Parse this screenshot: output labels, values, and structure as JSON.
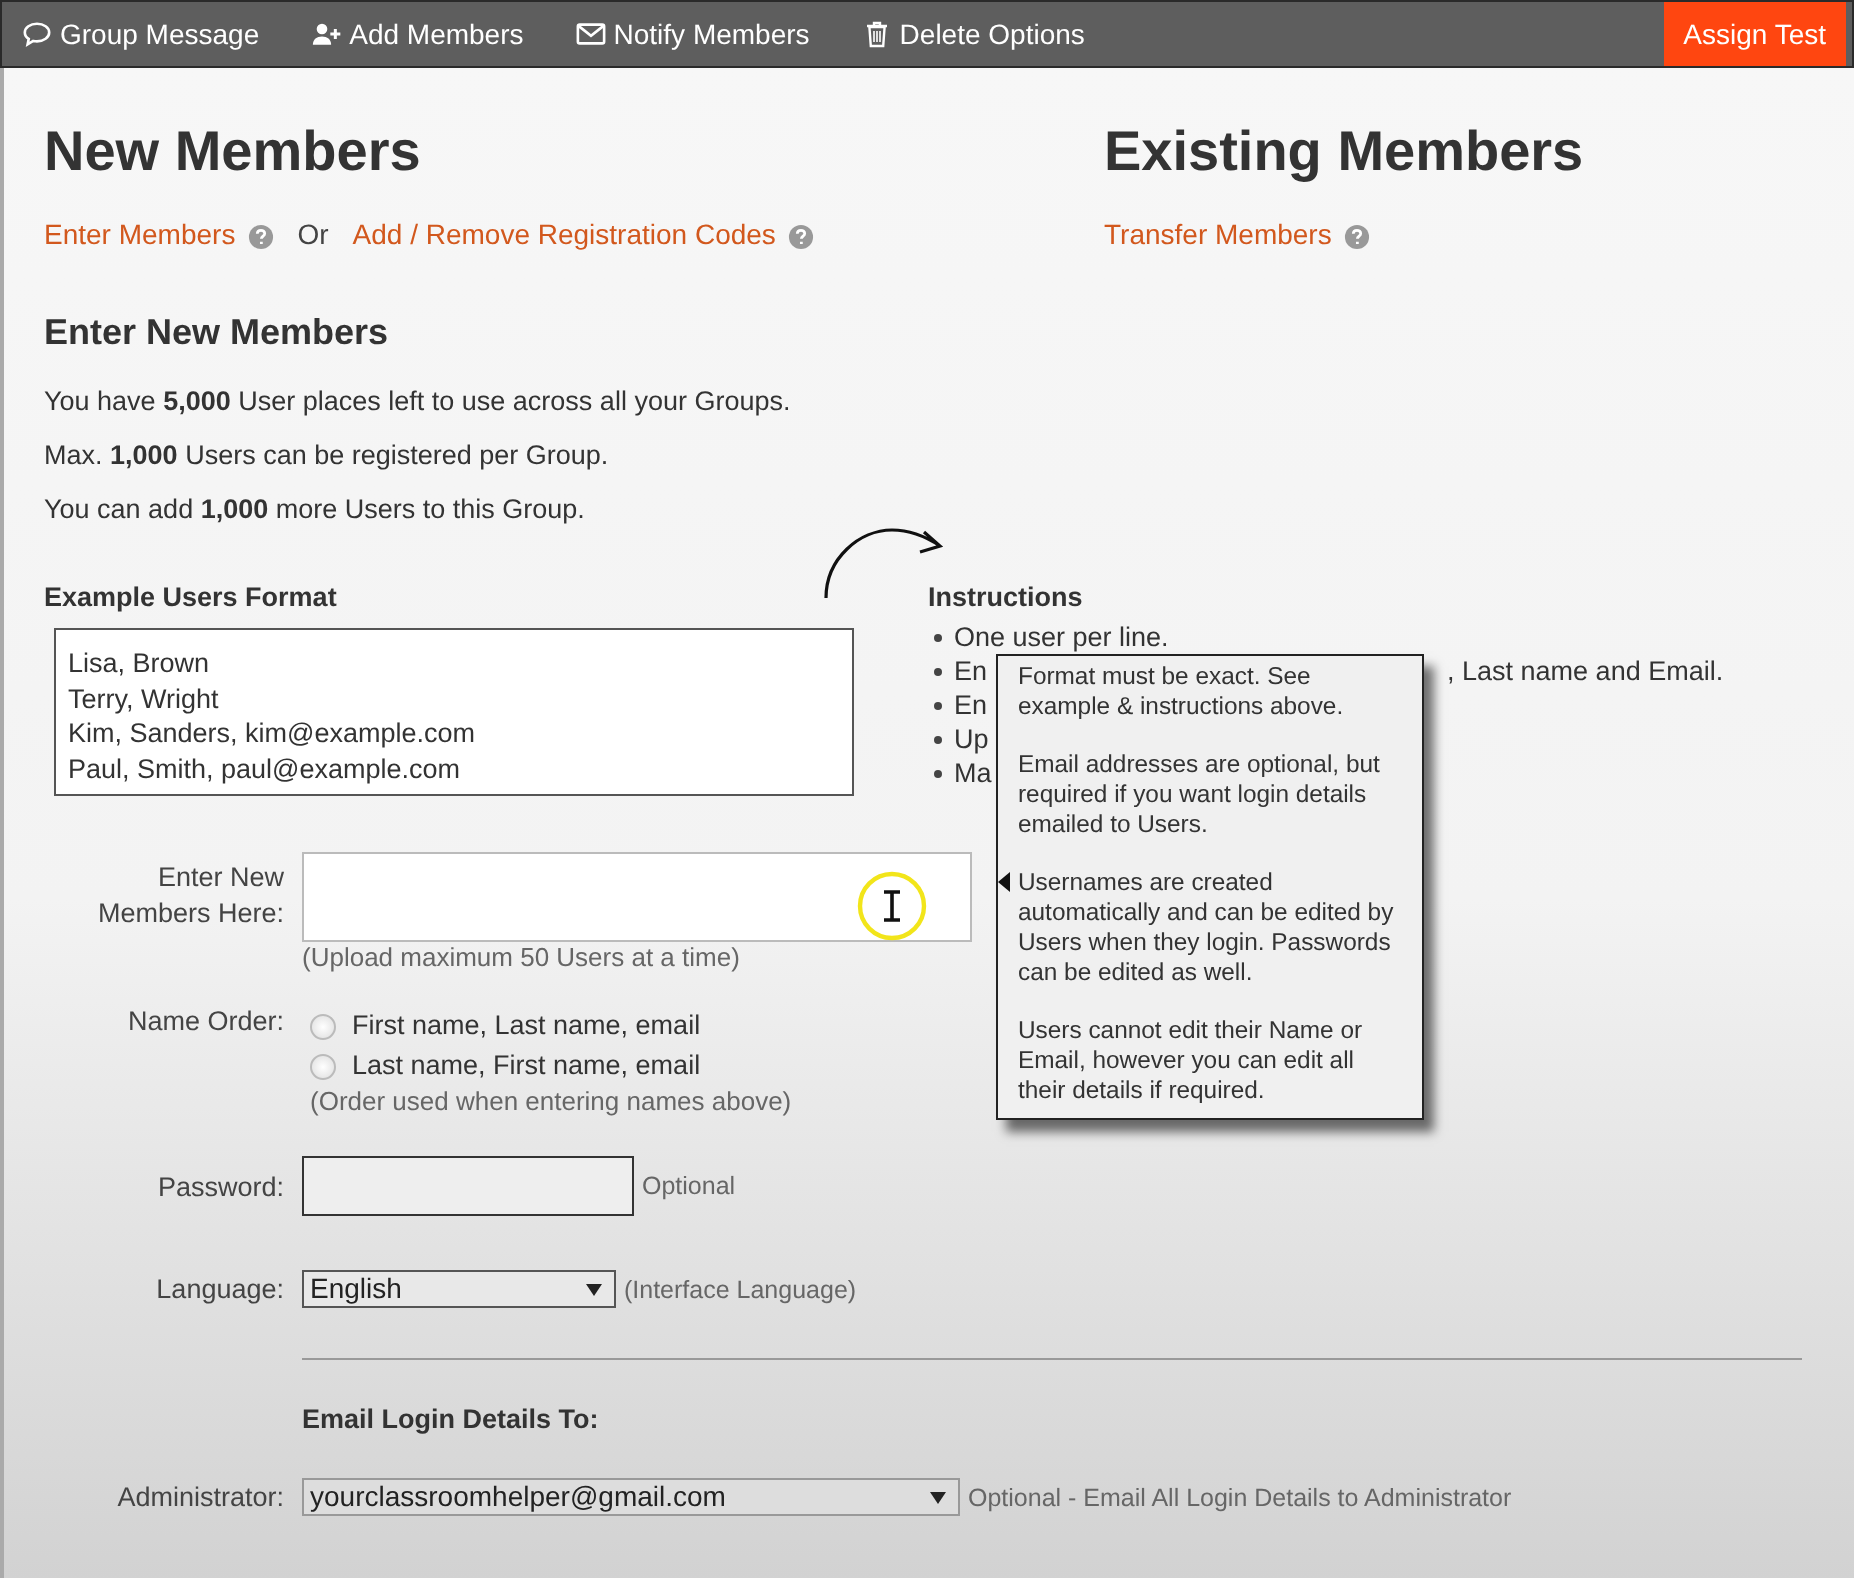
{
  "toolbar": {
    "items": [
      {
        "kind": "chat",
        "label": "Group Message"
      },
      {
        "kind": "user-plus",
        "label": "Add Members"
      },
      {
        "kind": "envelope",
        "label": "Notify Members"
      },
      {
        "kind": "trash",
        "label": "Delete Options"
      }
    ],
    "action_button": "Assign Test"
  },
  "new_members": {
    "title": "New Members",
    "link_1": "Enter Members",
    "separator": "Or",
    "link_2": "Add / Remove Registration Codes"
  },
  "existing_members": {
    "title": "Existing Members",
    "link": "Transfer Members"
  },
  "section_title": "Enter New Members",
  "info_lines": [
    "You have **5,000** User places left to use across all your Groups.",
    "Max. **1,000** Users can be registered per Group.",
    "You can add **1,000** more Users to this Group."
  ],
  "example": {
    "label": "Example Users Format",
    "lines": [
      "Lisa, Brown",
      "Terry, Wright",
      "Kim, Sanders, kim@example.com",
      "Paul, Smith, paul@example.com"
    ]
  },
  "instructions": {
    "title": "Instructions",
    "items": [
      {
        "start": "One user per line."
      },
      {
        "start": "En",
        "end": ", Last name and Email."
      },
      {
        "start": "En"
      },
      {
        "start": "Up"
      },
      {
        "start": "Ma"
      }
    ]
  },
  "tooltip": {
    "paragraphs": [
      "Format must be exact. See example & instructions above.",
      "Email addresses are optional, but required if you want login details emailed to Users.",
      "Usernames are created automatically and can be edited by Users when they login. Passwords can be edited as well.",
      "Users cannot edit their Name or Email, however you can edit all their details if required."
    ]
  },
  "members_field": {
    "label": "Enter New Members Here:",
    "note": "(Upload maximum 50 Users at a time)"
  },
  "name_order": {
    "label": "Name Order:",
    "options": [
      {
        "label": "First name, Last name, email",
        "selected": false
      },
      {
        "label": "Last name, First name, email",
        "selected": false
      }
    ],
    "note": "(Order used when entering names above)"
  },
  "password": {
    "label": "Password:",
    "hint": "Optional"
  },
  "language": {
    "label": "Language:",
    "value": "English",
    "hint": "(Interface Language)"
  },
  "email_section": {
    "title": "Email Login Details To:",
    "label": "Administrator:",
    "value": "yourclassroomhelper@gmail.com",
    "hint": "Optional - Email All Login Details to Administrator"
  }
}
